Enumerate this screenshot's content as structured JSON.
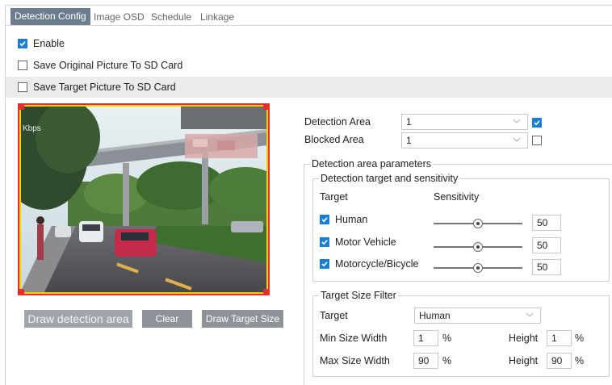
{
  "tabs": [
    {
      "label": "Detection Config",
      "active": true
    },
    {
      "label": "Image OSD",
      "active": false
    },
    {
      "label": "Schedule",
      "active": false
    },
    {
      "label": "Linkage",
      "active": false
    }
  ],
  "options": {
    "enable": {
      "label": "Enable",
      "checked": true
    },
    "save_original": {
      "label": "Save Original Picture To SD Card",
      "checked": false
    },
    "save_target": {
      "label": "Save Target Picture To SD Card",
      "checked": false
    }
  },
  "video_overlay": {
    "bitrate_text": "Kbps"
  },
  "buttons": {
    "draw_area": "Draw detection area",
    "clear": "Clear",
    "draw_target_size": "Draw Target Size"
  },
  "detection_area": {
    "label": "Detection Area",
    "value": "1",
    "checked": true
  },
  "blocked_area": {
    "label": "Blocked Area",
    "value": "1",
    "checked": false
  },
  "area_params": {
    "legend": "Detection area parameters",
    "targets_group": {
      "legend": "Detection target and sensitivity",
      "col_target": "Target",
      "col_sensitivity": "Sensitivity",
      "items": [
        {
          "label": "Human",
          "checked": true,
          "sensitivity": "50",
          "level": 0.5
        },
        {
          "label": "Motor Vehicle",
          "checked": true,
          "sensitivity": "50",
          "level": 0.5
        },
        {
          "label": "Motorcycle/Bicycle",
          "checked": true,
          "sensitivity": "50",
          "level": 0.5
        }
      ]
    },
    "size_filter": {
      "legend": "Target Size Filter",
      "target_label": "Target",
      "target_value": "Human",
      "min_width_label": "Min Size Width",
      "min_width": "1",
      "min_height_label": "Height",
      "min_height": "1",
      "max_width_label": "Max Size Width",
      "max_width": "90",
      "max_height_label": "Height",
      "max_height": "90",
      "unit": "%"
    }
  },
  "colors": {
    "accent": "#1a7fd4",
    "tab_active": "#6b7d8e",
    "button": "#8d9399",
    "zone_border": "#e8d200",
    "zone_corner": "#e03030"
  }
}
